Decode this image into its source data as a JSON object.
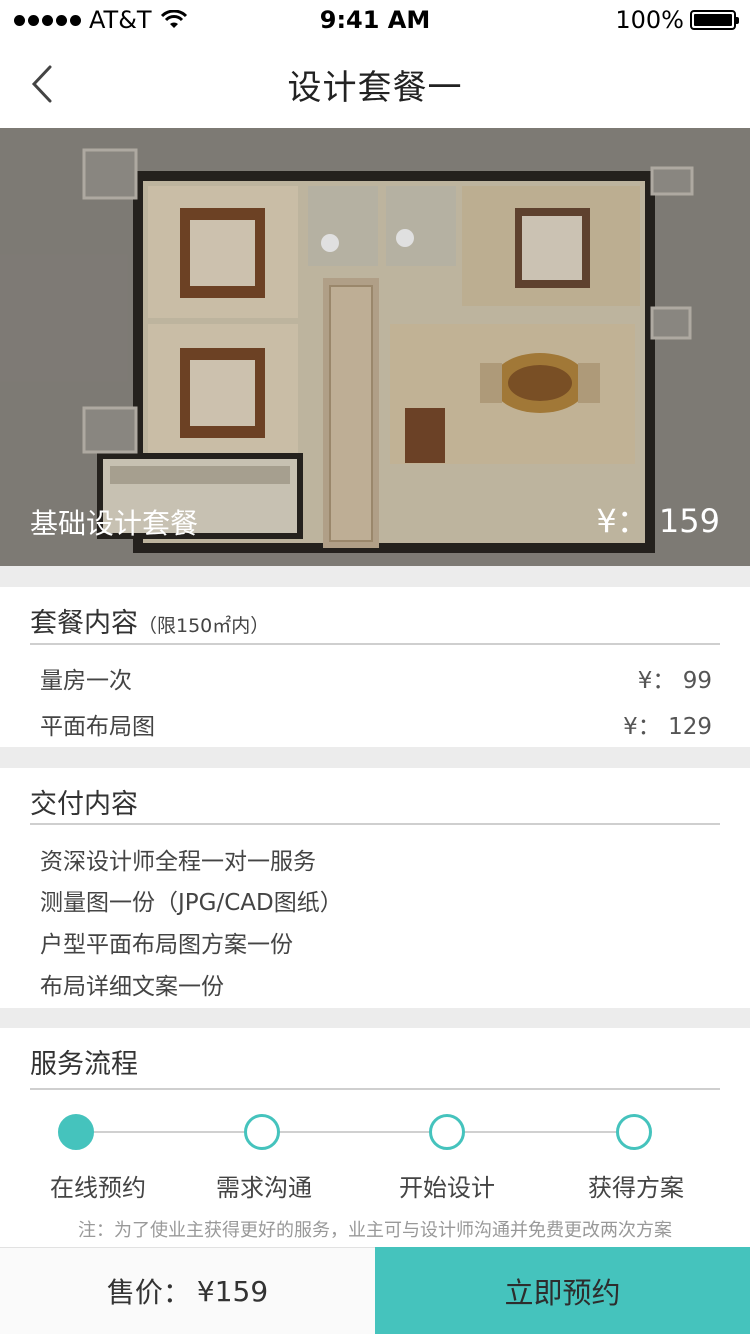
{
  "status": {
    "carrier": "AT&T",
    "time": "9:41 AM",
    "battery": "100%"
  },
  "nav": {
    "title": "设计套餐一"
  },
  "hero": {
    "name": "基础设计套餐",
    "price": "¥： 159"
  },
  "package": {
    "title": "套餐内容",
    "limit": "（限150㎡内）",
    "items": [
      {
        "name": "量房一次",
        "price": "¥： 99"
      },
      {
        "name": "平面布局图",
        "price": "¥： 129"
      }
    ]
  },
  "delivery": {
    "title": "交付内容",
    "items": [
      "资深设计师全程一对一服务",
      "测量图一份（JPG/CAD图纸）",
      "户型平面布局图方案一份",
      "布局详细文案一份"
    ]
  },
  "process": {
    "title": "服务流程",
    "steps": [
      "在线预约",
      "需求沟通",
      "开始设计",
      "获得方案"
    ],
    "active_step": 0,
    "note": "注：为了使业主获得更好的服务，业主可与设计师沟通并免费更改两次方案"
  },
  "bottom": {
    "price_label": "售价：",
    "price_value": "¥159",
    "book_label": "立即预约"
  },
  "colors": {
    "accent": "#45c3bd",
    "background": "#ececec"
  },
  "icons": [
    "signal-icon",
    "wifi-icon",
    "battery-icon",
    "back-arrow-icon",
    "floor-plan-image"
  ]
}
